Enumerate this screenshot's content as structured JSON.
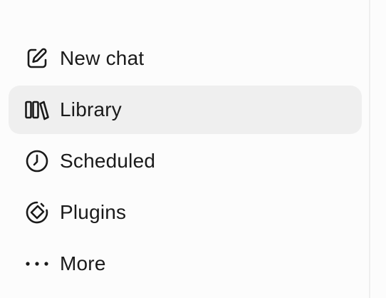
{
  "sidebar": {
    "items": [
      {
        "label": "New chat",
        "icon": "compose-icon",
        "active": false
      },
      {
        "label": "Library",
        "icon": "library-icon",
        "active": true
      },
      {
        "label": "Scheduled",
        "icon": "clock-icon",
        "active": false
      },
      {
        "label": "Plugins",
        "icon": "plugin-icon",
        "active": false
      },
      {
        "label": "More",
        "icon": "more-icon",
        "active": false
      }
    ]
  },
  "colors": {
    "background": "#fcfcfc",
    "active_background": "#efefef",
    "text": "#1a1a1a",
    "divider": "#efefef"
  }
}
